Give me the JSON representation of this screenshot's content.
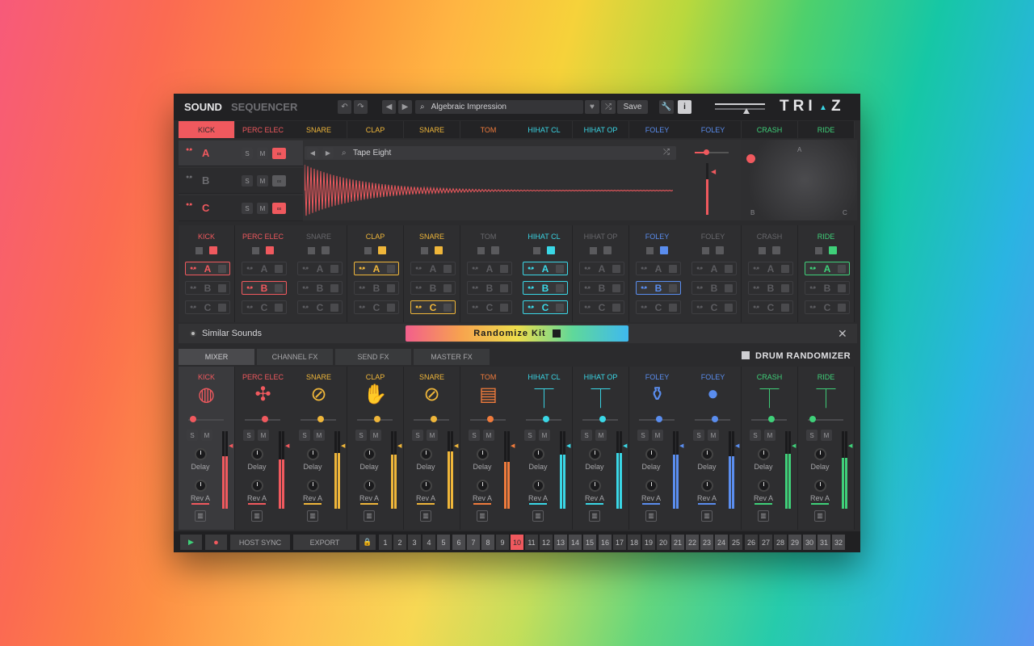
{
  "header": {
    "title_sound": "SOUND",
    "title_sequencer": "SEQUENCER",
    "preset": "Algebraic Impression",
    "save": "Save",
    "info": "i",
    "logo": "TRI",
    "logo_z": "Z"
  },
  "tracks": [
    {
      "label": "KICK",
      "color": "#f0595e"
    },
    {
      "label": "PERC ELEC",
      "color": "#f0595e"
    },
    {
      "label": "SNARE",
      "color": "#efb63a"
    },
    {
      "label": "CLAP",
      "color": "#efb63a"
    },
    {
      "label": "SNARE",
      "color": "#efb63a"
    },
    {
      "label": "TOM",
      "color": "#ef7b3c"
    },
    {
      "label": "HIHAT CL",
      "color": "#3ad7e6"
    },
    {
      "label": "HIHAT OP",
      "color": "#3ad7e6"
    },
    {
      "label": "FOLEY",
      "color": "#5a8dee"
    },
    {
      "label": "FOLEY",
      "color": "#5a8dee"
    },
    {
      "label": "CRASH",
      "color": "#3fd079"
    },
    {
      "label": "RIDE",
      "color": "#3fd079"
    }
  ],
  "layers": {
    "a": "A",
    "b": "B",
    "c": "C",
    "s": "S",
    "m": "M",
    "sample": "Tape Eight"
  },
  "xy": {
    "a": "A",
    "b": "B",
    "c": "C"
  },
  "randomizer": {
    "similar": "Similar Sounds",
    "randomize": "Randomize Kit",
    "close": "✕",
    "drum": "DRUM RANDOMIZER",
    "cols": [
      {
        "label": "KICK",
        "lock": "open",
        "sel": [
          "A"
        ]
      },
      {
        "label": "PERC ELEC",
        "lock": "open",
        "sel": [
          "B"
        ]
      },
      {
        "label": "SNARE",
        "lock": "none",
        "sel": []
      },
      {
        "label": "CLAP",
        "lock": "open",
        "sel": [
          "A"
        ]
      },
      {
        "label": "SNARE",
        "lock": "open",
        "sel": [
          "C"
        ]
      },
      {
        "label": "TOM",
        "lock": "none",
        "sel": []
      },
      {
        "label": "HIHAT CL",
        "lock": "open",
        "sel": [
          "A",
          "B",
          "C"
        ]
      },
      {
        "label": "HIHAT OP",
        "lock": "none",
        "sel": []
      },
      {
        "label": "FOLEY",
        "lock": "open",
        "sel": [
          "B"
        ]
      },
      {
        "label": "FOLEY",
        "lock": "none",
        "sel": []
      },
      {
        "label": "CRASH",
        "lock": "none",
        "sel": []
      },
      {
        "label": "RIDE",
        "lock": "open",
        "sel": [
          "A"
        ]
      }
    ]
  },
  "mixer": {
    "tabs": [
      "MIXER",
      "CHANNEL FX",
      "SEND FX",
      "MASTER FX"
    ],
    "delay": "Delay",
    "rev": "Rev A",
    "s": "S",
    "m": "M",
    "icons": [
      "kick-drum-icon",
      "perc-electronic-icon",
      "snare-drum-icon",
      "clap-hands-icon",
      "snare-drum-icon",
      "tom-drum-icon",
      "hihat-closed-icon",
      "hihat-open-icon",
      "foley-shaker-icon",
      "foley-bomb-icon",
      "crash-cymbal-icon",
      "ride-cymbal-icon"
    ],
    "levels": [
      0.68,
      0.64,
      0.72,
      0.7,
      0.74,
      0.6,
      0.7,
      0.72,
      0.7,
      0.68,
      0.71,
      0.66
    ]
  },
  "transport": {
    "play": "▶",
    "record": "●",
    "host_sync": "HOST SYNC",
    "export": "EXPORT",
    "steps": [
      "1",
      "2",
      "3",
      "4",
      "5",
      "6",
      "7",
      "8",
      "9",
      "10",
      "11",
      "12",
      "13",
      "14",
      "15",
      "16",
      "17",
      "18",
      "19",
      "20",
      "21",
      "22",
      "23",
      "24",
      "25",
      "26",
      "27",
      "28",
      "29",
      "30",
      "31",
      "32"
    ],
    "active_step": "10"
  }
}
